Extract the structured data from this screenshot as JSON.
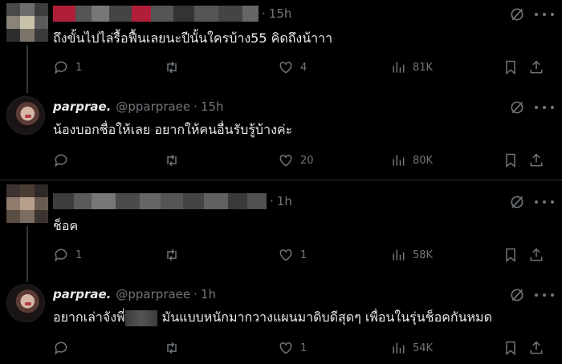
{
  "tweets": [
    {
      "name": "",
      "handle": "",
      "time": "15h",
      "text": "ถึงขั้นไปไล่รื้อฟื้นเลยนะปีนั้นใครบ้าง55  คิดถึงน้าาา",
      "replies": "1",
      "retweets": "",
      "likes": "4",
      "views": "81K",
      "redacted_name": true
    },
    {
      "name": "parprae.",
      "handle": "@pparpraee",
      "time": "15h",
      "text": "น้องบอกชื่อให้เลย อยากให้คนอื่นรับรู้บ้างค่ะ",
      "replies": "",
      "retweets": "",
      "likes": "20",
      "views": "80K"
    },
    {
      "name": "",
      "handle": "",
      "time": "1h",
      "text": "ช็อค",
      "replies": "1",
      "retweets": "",
      "likes": "1",
      "views": "58K",
      "redacted_name": true
    },
    {
      "name": "parprae.",
      "handle": "@pparpraee",
      "time": "1h",
      "text_before": "อยากเล่าจังพี่",
      "text_after": "มันแบบหนักมากวางแผนมาดิบดีสุดๆ เพื่อนในรุ่นช็อคกันหมด",
      "replies": "",
      "retweets": "",
      "likes": "1",
      "views": "54K"
    }
  ],
  "separator": "·",
  "icons": [
    "reply-icon",
    "retweet-icon",
    "like-icon",
    "views-icon",
    "bookmark-icon",
    "share-icon",
    "grok-icon",
    "more-icon"
  ]
}
